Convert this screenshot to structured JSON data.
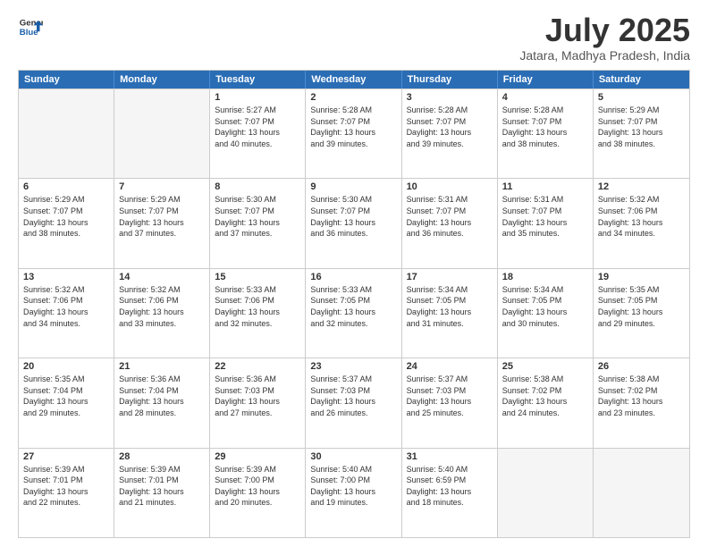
{
  "header": {
    "logo_line1": "General",
    "logo_line2": "Blue",
    "month": "July 2025",
    "location": "Jatara, Madhya Pradesh, India"
  },
  "weekdays": [
    "Sunday",
    "Monday",
    "Tuesday",
    "Wednesday",
    "Thursday",
    "Friday",
    "Saturday"
  ],
  "rows": [
    [
      {
        "day": "",
        "info": ""
      },
      {
        "day": "",
        "info": ""
      },
      {
        "day": "1",
        "info": "Sunrise: 5:27 AM\nSunset: 7:07 PM\nDaylight: 13 hours\nand 40 minutes."
      },
      {
        "day": "2",
        "info": "Sunrise: 5:28 AM\nSunset: 7:07 PM\nDaylight: 13 hours\nand 39 minutes."
      },
      {
        "day": "3",
        "info": "Sunrise: 5:28 AM\nSunset: 7:07 PM\nDaylight: 13 hours\nand 39 minutes."
      },
      {
        "day": "4",
        "info": "Sunrise: 5:28 AM\nSunset: 7:07 PM\nDaylight: 13 hours\nand 38 minutes."
      },
      {
        "day": "5",
        "info": "Sunrise: 5:29 AM\nSunset: 7:07 PM\nDaylight: 13 hours\nand 38 minutes."
      }
    ],
    [
      {
        "day": "6",
        "info": "Sunrise: 5:29 AM\nSunset: 7:07 PM\nDaylight: 13 hours\nand 38 minutes."
      },
      {
        "day": "7",
        "info": "Sunrise: 5:29 AM\nSunset: 7:07 PM\nDaylight: 13 hours\nand 37 minutes."
      },
      {
        "day": "8",
        "info": "Sunrise: 5:30 AM\nSunset: 7:07 PM\nDaylight: 13 hours\nand 37 minutes."
      },
      {
        "day": "9",
        "info": "Sunrise: 5:30 AM\nSunset: 7:07 PM\nDaylight: 13 hours\nand 36 minutes."
      },
      {
        "day": "10",
        "info": "Sunrise: 5:31 AM\nSunset: 7:07 PM\nDaylight: 13 hours\nand 36 minutes."
      },
      {
        "day": "11",
        "info": "Sunrise: 5:31 AM\nSunset: 7:07 PM\nDaylight: 13 hours\nand 35 minutes."
      },
      {
        "day": "12",
        "info": "Sunrise: 5:32 AM\nSunset: 7:06 PM\nDaylight: 13 hours\nand 34 minutes."
      }
    ],
    [
      {
        "day": "13",
        "info": "Sunrise: 5:32 AM\nSunset: 7:06 PM\nDaylight: 13 hours\nand 34 minutes."
      },
      {
        "day": "14",
        "info": "Sunrise: 5:32 AM\nSunset: 7:06 PM\nDaylight: 13 hours\nand 33 minutes."
      },
      {
        "day": "15",
        "info": "Sunrise: 5:33 AM\nSunset: 7:06 PM\nDaylight: 13 hours\nand 32 minutes."
      },
      {
        "day": "16",
        "info": "Sunrise: 5:33 AM\nSunset: 7:05 PM\nDaylight: 13 hours\nand 32 minutes."
      },
      {
        "day": "17",
        "info": "Sunrise: 5:34 AM\nSunset: 7:05 PM\nDaylight: 13 hours\nand 31 minutes."
      },
      {
        "day": "18",
        "info": "Sunrise: 5:34 AM\nSunset: 7:05 PM\nDaylight: 13 hours\nand 30 minutes."
      },
      {
        "day": "19",
        "info": "Sunrise: 5:35 AM\nSunset: 7:05 PM\nDaylight: 13 hours\nand 29 minutes."
      }
    ],
    [
      {
        "day": "20",
        "info": "Sunrise: 5:35 AM\nSunset: 7:04 PM\nDaylight: 13 hours\nand 29 minutes."
      },
      {
        "day": "21",
        "info": "Sunrise: 5:36 AM\nSunset: 7:04 PM\nDaylight: 13 hours\nand 28 minutes."
      },
      {
        "day": "22",
        "info": "Sunrise: 5:36 AM\nSunset: 7:03 PM\nDaylight: 13 hours\nand 27 minutes."
      },
      {
        "day": "23",
        "info": "Sunrise: 5:37 AM\nSunset: 7:03 PM\nDaylight: 13 hours\nand 26 minutes."
      },
      {
        "day": "24",
        "info": "Sunrise: 5:37 AM\nSunset: 7:03 PM\nDaylight: 13 hours\nand 25 minutes."
      },
      {
        "day": "25",
        "info": "Sunrise: 5:38 AM\nSunset: 7:02 PM\nDaylight: 13 hours\nand 24 minutes."
      },
      {
        "day": "26",
        "info": "Sunrise: 5:38 AM\nSunset: 7:02 PM\nDaylight: 13 hours\nand 23 minutes."
      }
    ],
    [
      {
        "day": "27",
        "info": "Sunrise: 5:39 AM\nSunset: 7:01 PM\nDaylight: 13 hours\nand 22 minutes."
      },
      {
        "day": "28",
        "info": "Sunrise: 5:39 AM\nSunset: 7:01 PM\nDaylight: 13 hours\nand 21 minutes."
      },
      {
        "day": "29",
        "info": "Sunrise: 5:39 AM\nSunset: 7:00 PM\nDaylight: 13 hours\nand 20 minutes."
      },
      {
        "day": "30",
        "info": "Sunrise: 5:40 AM\nSunset: 7:00 PM\nDaylight: 13 hours\nand 19 minutes."
      },
      {
        "day": "31",
        "info": "Sunrise: 5:40 AM\nSunset: 6:59 PM\nDaylight: 13 hours\nand 18 minutes."
      },
      {
        "day": "",
        "info": ""
      },
      {
        "day": "",
        "info": ""
      }
    ]
  ]
}
